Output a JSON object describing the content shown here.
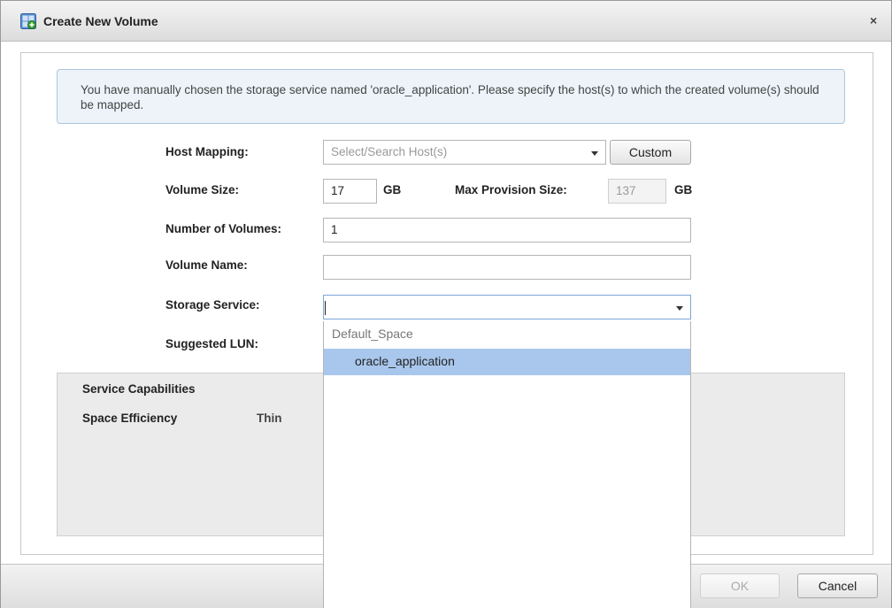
{
  "dialog": {
    "title": "Create New Volume",
    "close_glyph": "×"
  },
  "info": {
    "message": "You have manually chosen the storage service named 'oracle_application'. Please specify the host(s) to which the created volume(s) should be mapped."
  },
  "form": {
    "host_mapping": {
      "label": "Host Mapping:",
      "placeholder": "Select/Search  Host(s)",
      "custom_button": "Custom"
    },
    "volume_size": {
      "label": "Volume Size:",
      "value": "17",
      "unit": "GB"
    },
    "max_provision_size": {
      "label": "Max Provision Size:",
      "value": "137",
      "unit": "GB"
    },
    "number_of_volumes": {
      "label": "Number of Volumes:",
      "value": "1"
    },
    "volume_name": {
      "label": "Volume Name:",
      "value": ""
    },
    "storage_service": {
      "label": "Storage Service:",
      "value": "",
      "options": [
        {
          "label": "Default_Space",
          "kind": "group"
        },
        {
          "label": "oracle_application",
          "kind": "option",
          "highlighted": true
        }
      ]
    },
    "suggested_lun": {
      "label": "Suggested LUN:"
    }
  },
  "capabilities": {
    "title": "Service Capabilities",
    "items": [
      {
        "label": "Space Efficiency",
        "value": "Thin"
      }
    ]
  },
  "footer": {
    "ok_label": "OK",
    "cancel_label": "Cancel"
  },
  "colors": {
    "highlight": "#a9c7ec",
    "info_bg": "#edf3f9",
    "info_border": "#a9c7e0"
  },
  "icons": {
    "title_icon": "create-volume-icon",
    "dropdown_caret": "chevron-down-icon"
  }
}
